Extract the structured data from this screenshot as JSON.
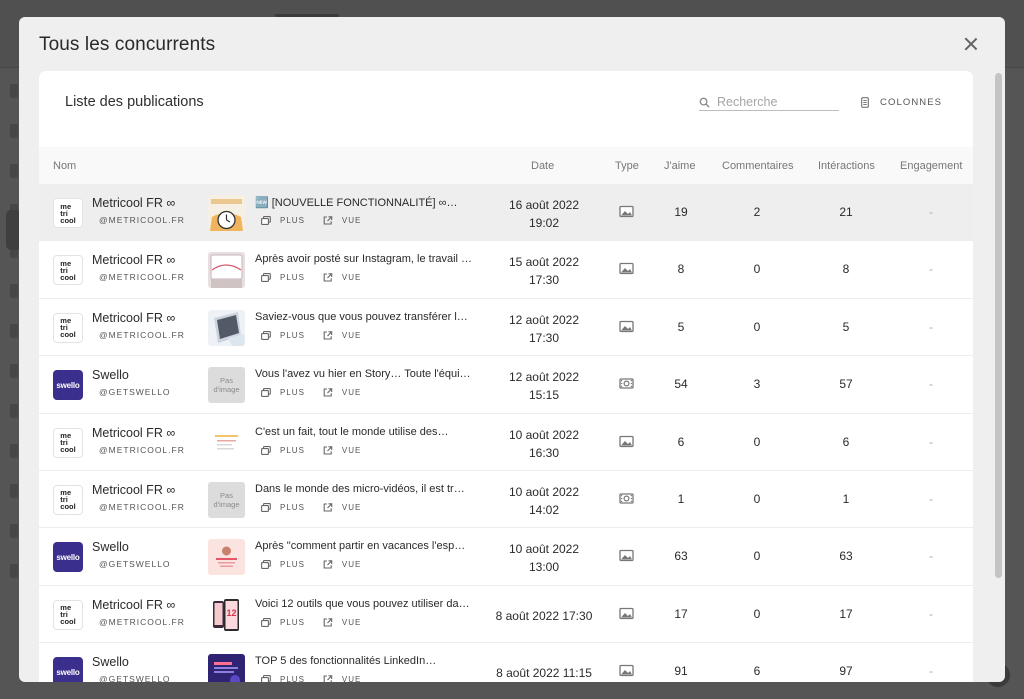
{
  "modal": {
    "title": "Tous les concurrents"
  },
  "card": {
    "title": "Liste des publications",
    "search_placeholder": "Recherche",
    "columns_label": "COLONNES"
  },
  "headers": {
    "name": "Nom",
    "date": "Date",
    "type": "Type",
    "likes": "J'aime",
    "comments": "Commentaires",
    "interactions": "Intéractions",
    "engagement": "Engagement"
  },
  "actions": {
    "more": "PLUS",
    "view": "VUE"
  },
  "logos": {
    "metricool": "metricool",
    "swello": "swello"
  },
  "no_image_label": "Pas d'image",
  "colors": {
    "swello_brand": "#3b2f8d",
    "highlight_row": "#eeeeee"
  },
  "rows": [
    {
      "account": "Metricool FR ∞",
      "handle": "@METRICOOL.FR",
      "logo": "metricool",
      "thumb": "clock-illustration",
      "text": "🆕 [NOUVELLE FONCTIONNALITÉ] ∞…",
      "date": "16 août 2022",
      "time": "19:02",
      "type": "image",
      "likes": "19",
      "comments": "2",
      "interactions": "21",
      "engagement": "-"
    },
    {
      "account": "Metricool FR ∞",
      "handle": "@METRICOOL.FR",
      "logo": "metricool",
      "thumb": "photo",
      "text": "Après avoir posté sur Instagram, le travail …",
      "date": "15 août 2022",
      "time": "17:30",
      "type": "image",
      "likes": "8",
      "comments": "0",
      "interactions": "8",
      "engagement": "-"
    },
    {
      "account": "Metricool FR ∞",
      "handle": "@METRICOOL.FR",
      "logo": "metricool",
      "thumb": "laptop",
      "text": "Saviez-vous que vous pouvez transférer l…",
      "date": "12 août 2022",
      "time": "17:30",
      "type": "image",
      "likes": "5",
      "comments": "0",
      "interactions": "5",
      "engagement": "-"
    },
    {
      "account": "Swello",
      "handle": "@GETSWELLO",
      "logo": "swello",
      "thumb": "none",
      "text": "Vous l'avez vu hier en Story… Toute l'équi…",
      "date": "12 août 2022",
      "time": "15:15",
      "type": "video",
      "likes": "54",
      "comments": "3",
      "interactions": "57",
      "engagement": "-"
    },
    {
      "account": "Metricool FR ∞",
      "handle": "@METRICOOL.FR",
      "logo": "metricool",
      "thumb": "document",
      "text": "C'est un fait, tout le monde utilise des…",
      "date": "10 août 2022",
      "time": "16:30",
      "type": "image",
      "likes": "6",
      "comments": "0",
      "interactions": "6",
      "engagement": "-"
    },
    {
      "account": "Metricool FR ∞",
      "handle": "@METRICOOL.FR",
      "logo": "metricool",
      "thumb": "none",
      "text": "Dans le monde des micro-vidéos, il est tr…",
      "date": "10 août 2022",
      "time": "14:02",
      "type": "video",
      "likes": "1",
      "comments": "0",
      "interactions": "1",
      "engagement": "-"
    },
    {
      "account": "Swello",
      "handle": "@GETSWELLO",
      "logo": "swello",
      "thumb": "pink-card",
      "text": "Après \"comment partir en vacances l'esp…",
      "date": "10 août 2022",
      "time": "13:00",
      "type": "image",
      "likes": "63",
      "comments": "0",
      "interactions": "63",
      "engagement": "-"
    },
    {
      "account": "Metricool FR ∞",
      "handle": "@METRICOOL.FR",
      "logo": "metricool",
      "thumb": "phone",
      "text": "Voici 12 outils que vous pouvez utiliser da…",
      "date": "8 août 2022 17:30",
      "time": "",
      "type": "image",
      "likes": "17",
      "comments": "0",
      "interactions": "17",
      "engagement": "-"
    },
    {
      "account": "Swello",
      "handle": "@GETSWELLO",
      "logo": "swello",
      "thumb": "purple-card",
      "text": "TOP 5 des fonctionnalités LinkedIn…",
      "date": "8 août 2022 11:15",
      "time": "",
      "type": "image",
      "likes": "91",
      "comments": "6",
      "interactions": "97",
      "engagement": "-"
    }
  ]
}
